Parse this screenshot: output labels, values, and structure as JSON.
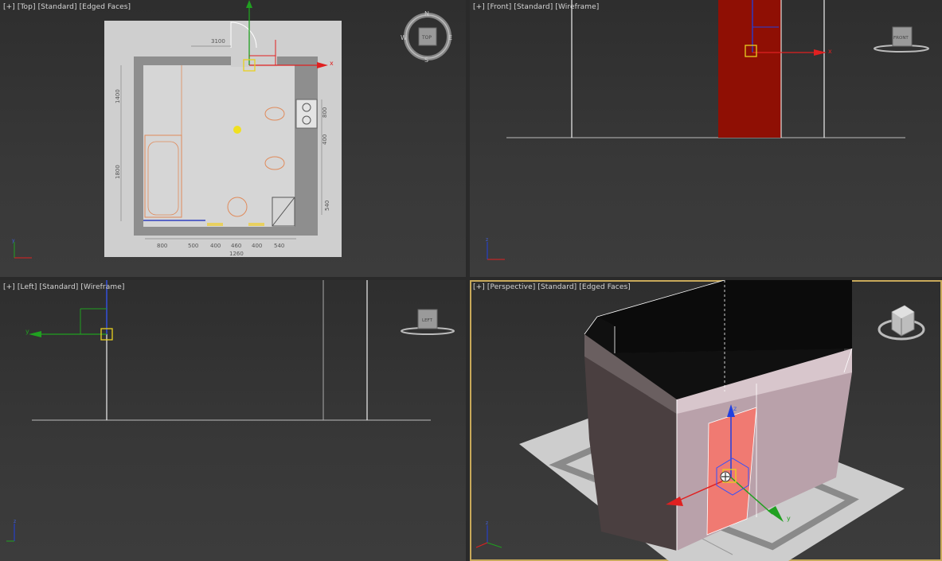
{
  "viewports": {
    "top": {
      "label_plus": "[+]",
      "label_view": "[Top]",
      "label_shading": "[Standard]",
      "label_mode": "[Edged Faces]"
    },
    "front": {
      "label_plus": "[+]",
      "label_view": "[Front]",
      "label_shading": "[Standard]",
      "label_mode": "[Wireframe]"
    },
    "left": {
      "label_plus": "[+]",
      "label_view": "[Left]",
      "label_shading": "[Standard]",
      "label_mode": "[Wireframe]"
    },
    "perspective": {
      "label_plus": "[+]",
      "label_view": "[Perspective]",
      "label_shading": "[Standard]",
      "label_mode": "[Edged Faces]"
    }
  },
  "viewcube": {
    "top_face": "TOP",
    "front_face": "FRONT",
    "left_face": "LEFT",
    "compass": {
      "n": "N",
      "s": "S",
      "e": "E",
      "w": "W"
    }
  },
  "gizmo": {
    "x": "x",
    "y": "y",
    "z": "z"
  },
  "blueprint": {
    "dims_top": "3100",
    "dims_left_1": "1400",
    "dims_left_2": "1800",
    "dims_right_1": "800",
    "dims_right_2": "400",
    "dims_right_3": "540",
    "dims_bottom": [
      "800",
      "500",
      "400",
      "460",
      "400",
      "540"
    ],
    "dims_total": "1260"
  },
  "colors": {
    "accent_border": "#c8a95a",
    "axis_x": "#e02020",
    "axis_y": "#20a020",
    "axis_z": "#2040e0",
    "selection": "#e8d020"
  }
}
